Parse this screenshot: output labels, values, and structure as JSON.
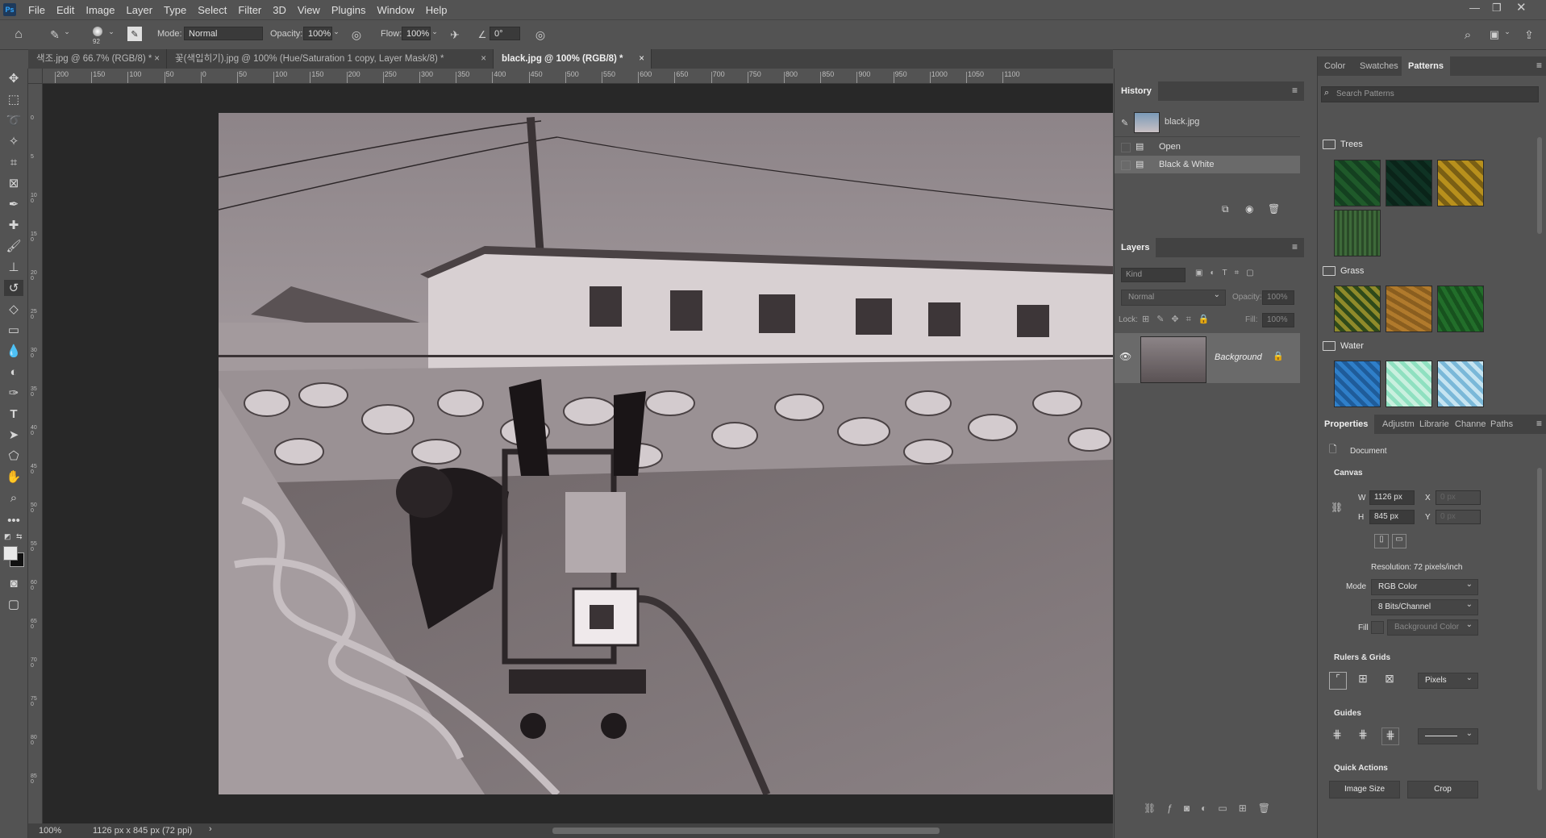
{
  "app": {
    "logo": "Ps"
  },
  "menu": [
    "File",
    "Edit",
    "Image",
    "Layer",
    "Type",
    "Select",
    "Filter",
    "3D",
    "View",
    "Plugins",
    "Window",
    "Help"
  ],
  "options": {
    "brush_size": "92",
    "mode_label": "Mode:",
    "mode_value": "Normal",
    "opacity_label": "Opacity:",
    "opacity_value": "100%",
    "flow_label": "Flow:",
    "flow_value": "100%",
    "angle_value": "0°"
  },
  "tabs": [
    {
      "label": "색조.jpg @ 66.7% (RGB/8) *",
      "close": "×"
    },
    {
      "label": "꽃(색입히기).jpg @ 100% (Hue/Saturation 1 copy, Layer Mask/8) *",
      "close": "×"
    },
    {
      "label": "black.jpg @ 100% (RGB/8) *",
      "close": "×"
    }
  ],
  "ruler": {
    "h_ticks": [
      "200",
      "150",
      "100",
      "50",
      "0",
      "50",
      "100",
      "150",
      "200",
      "250",
      "300",
      "350",
      "400",
      "450",
      "500",
      "550",
      "600",
      "650",
      "700",
      "750",
      "800",
      "850",
      "900",
      "950",
      "1000",
      "1050",
      "1100"
    ],
    "v_ticks": [
      "0",
      "5",
      "1 0 0",
      "1 5 0",
      "2 0 0",
      "2 5 0",
      "3 0 0",
      "3 5 0",
      "4 0 0",
      "4 5 0",
      "5 0 0",
      "5 5 0",
      "6 0 0",
      "6 5 0",
      "7 0 0",
      "7 5 0",
      "8 0 0",
      "8 5 0"
    ]
  },
  "status": {
    "zoom": "100%",
    "doc_info": "1126 px x 845 px (72 ppi)",
    "arrow": "›"
  },
  "history": {
    "title": "History",
    "snapshot": "black.jpg",
    "items": [
      "Open",
      "Black & White"
    ]
  },
  "layers": {
    "title": "Layers",
    "kind_placeholder": "Kind",
    "blend": "Normal",
    "opacity_label": "Opacity:",
    "opacity_value": "100%",
    "lock_label": "Lock:",
    "fill_label": "Fill:",
    "fill_value": "100%",
    "layer_name": "Background"
  },
  "right_tabs": [
    "Color",
    "Swatches",
    "Patterns"
  ],
  "patterns": {
    "search_placeholder": "Search Patterns",
    "groups": [
      {
        "name": "Trees",
        "colors": [
          "#1f5a2a",
          "#0f3324",
          "#b8901c",
          "#3e6a3a"
        ]
      },
      {
        "name": "Grass",
        "colors": [
          "#8f8a2a",
          "#b07a2c",
          "#226e2a"
        ]
      },
      {
        "name": "Water",
        "colors": [
          "#2f7fc9",
          "#8fe0c0",
          "#7ab8d8"
        ]
      }
    ]
  },
  "properties": {
    "tabs": [
      "Properties",
      "Adjustm",
      "Librarie",
      "Channe",
      "Paths"
    ],
    "doc_label": "Document",
    "canvas_label": "Canvas",
    "w_label": "W",
    "w_value": "1126 px",
    "h_label": "H",
    "h_value": "845 px",
    "x_label": "X",
    "x_value": "0 px",
    "y_label": "Y",
    "y_value": "0 px",
    "resolution": "Resolution: 72 pixels/inch",
    "mode_label": "Mode",
    "mode_value": "RGB Color",
    "bits_value": "8 Bits/Channel",
    "fill_label": "Fill",
    "fill_value": "Background Color",
    "rulers_label": "Rulers & Grids",
    "units_value": "Pixels",
    "guides_label": "Guides",
    "quick_actions_label": "Quick Actions",
    "image_size_btn": "Image Size",
    "crop_btn": "Crop"
  }
}
